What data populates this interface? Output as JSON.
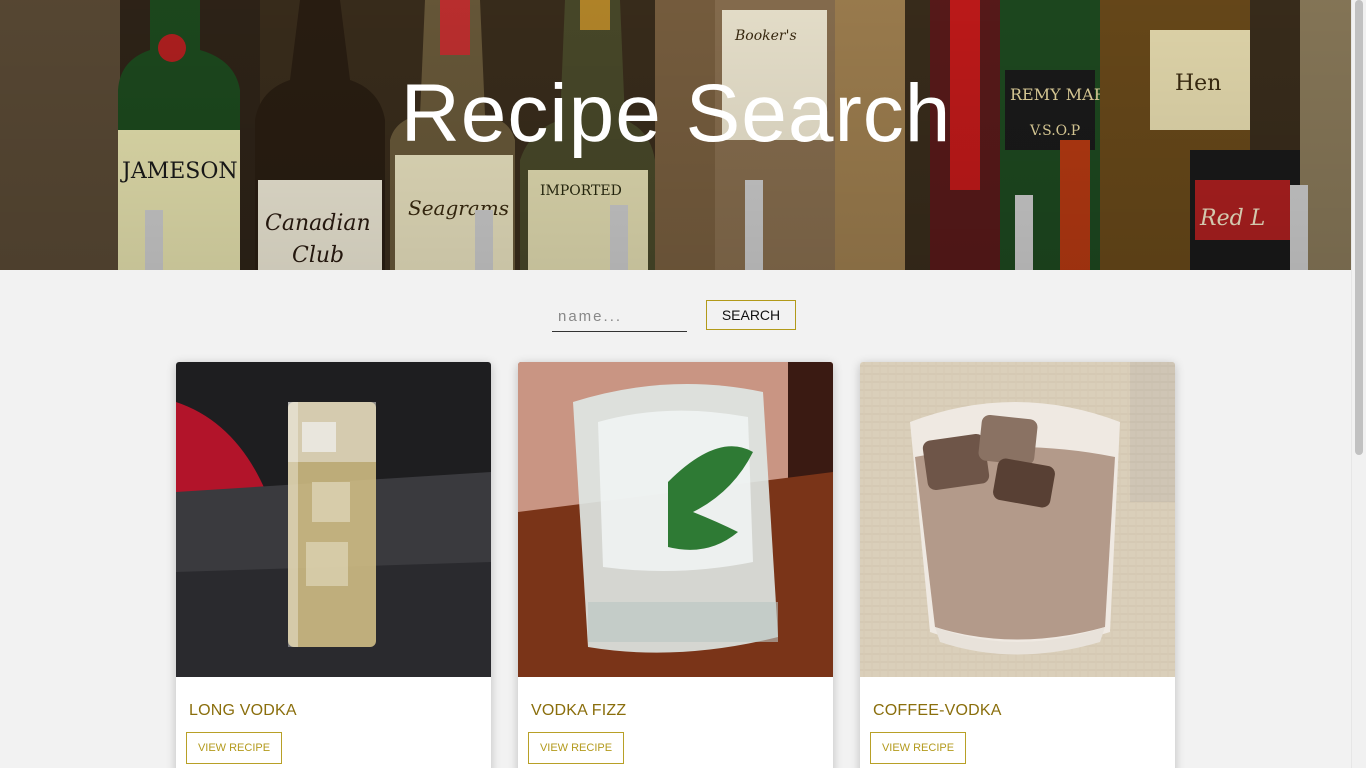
{
  "header": {
    "title": "Recipe Search"
  },
  "search": {
    "placeholder": "name...",
    "value": "",
    "button_label": "SEARCH"
  },
  "recipes": [
    {
      "name": "LONG VODKA",
      "button_label": "VIEW RECIPE"
    },
    {
      "name": "VODKA FIZZ",
      "button_label": "VIEW RECIPE"
    },
    {
      "name": "COFFEE-VODKA",
      "button_label": "VIEW RECIPE"
    }
  ],
  "colors": {
    "accent": "#b8a027",
    "title_gold": "#8a6e0c",
    "background": "#f2f2f2"
  }
}
